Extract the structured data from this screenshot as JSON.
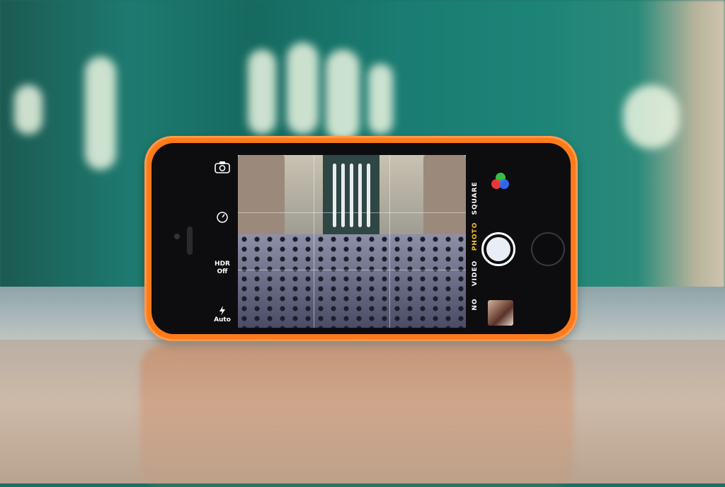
{
  "camera_controls": {
    "hdr_label": "HDR",
    "hdr_value": "Off",
    "flash_label": "Auto",
    "camera_switch_icon": "camera-switch-icon",
    "timer_icon": "timer-icon",
    "flash_icon": "lightning-icon"
  },
  "modes": {
    "pano_partial": "NO",
    "video": "VIDEO",
    "photo": "PHOTO",
    "square": "SQUARE",
    "active": "PHOTO"
  },
  "colors": {
    "case": "#ff7a1a",
    "active_mode": "#f7c326",
    "filter_red": "#ff3b3b",
    "filter_green": "#3bd14a",
    "filter_blue": "#3b6dff"
  }
}
